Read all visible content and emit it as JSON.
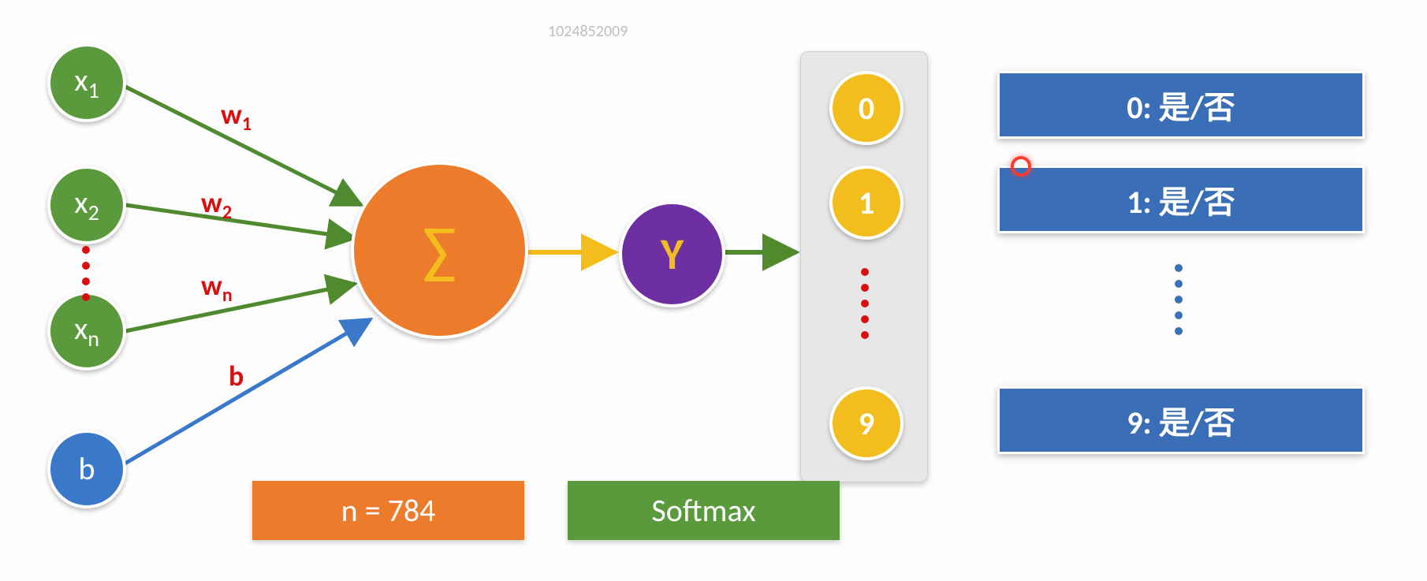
{
  "watermark": "1024852009",
  "inputs": {
    "x1": "x",
    "x1_sub": "1",
    "x2": "x",
    "x2_sub": "2",
    "xn": "x",
    "xn_sub": "n",
    "bias": "b"
  },
  "weights": {
    "w1": "w",
    "w1_sub": "1",
    "w2": "w",
    "w2_sub": "2",
    "wn": "w",
    "wn_sub": "n",
    "b": "b"
  },
  "sum_symbol": "∑",
  "y_symbol": "Y",
  "output_nodes": {
    "o0": "0",
    "o1": "1",
    "o9": "9"
  },
  "output_bars": {
    "b0": "0: 是/否",
    "b1": "1: 是/否",
    "b9": "9: 是/否"
  },
  "caption_n": "n = 784",
  "caption_softmax": "Softmax"
}
